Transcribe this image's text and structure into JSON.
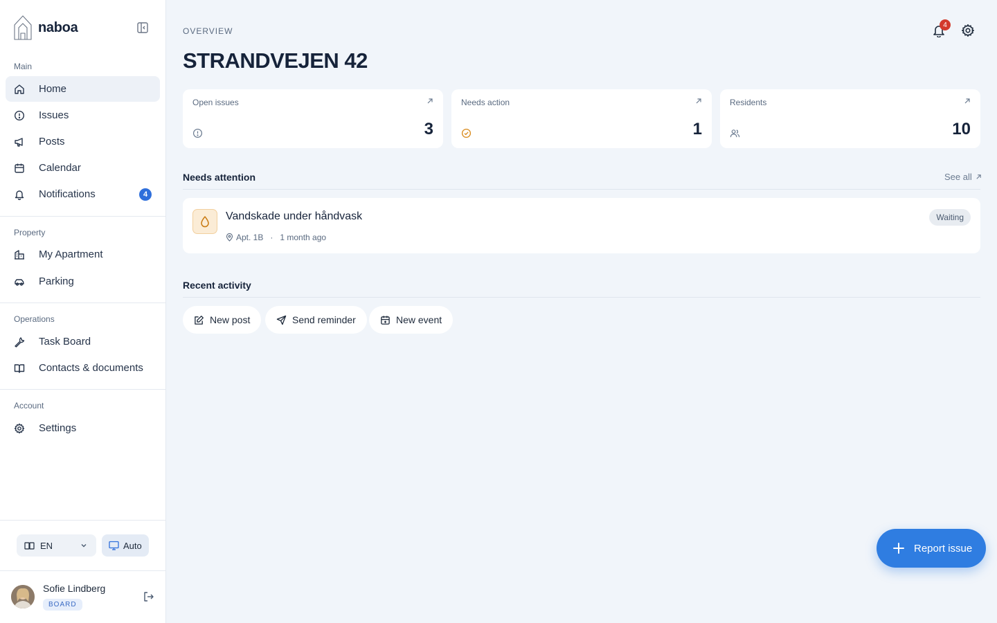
{
  "brand": {
    "name": "naboa"
  },
  "sidebar": {
    "sections": [
      {
        "label": "Main"
      },
      {
        "label": "Property"
      },
      {
        "label": "Operations"
      },
      {
        "label": "Account"
      }
    ],
    "items": [
      {
        "label": "Home",
        "icon": "home-icon",
        "active": true
      },
      {
        "label": "Issues",
        "icon": "alert-circle-icon"
      },
      {
        "label": "Posts",
        "icon": "megaphone-icon"
      },
      {
        "label": "Calendar",
        "icon": "calendar-icon"
      },
      {
        "label": "Notifications",
        "icon": "bell-icon",
        "badge": "4"
      },
      {
        "label": "My Apartment",
        "icon": "building-icon"
      },
      {
        "label": "Parking",
        "icon": "car-icon"
      },
      {
        "label": "Task Board",
        "icon": "wrench-icon"
      },
      {
        "label": "Contacts & documents",
        "icon": "book-icon"
      },
      {
        "label": "Settings",
        "icon": "gear-icon"
      }
    ],
    "language": {
      "selected": "EN"
    },
    "theme": {
      "label": "Auto"
    },
    "user": {
      "name": "Sofie Lindberg",
      "role": "BOARD"
    }
  },
  "header": {
    "overline": "OVERVIEW",
    "title": "STRANDVEJEN 42",
    "notification_count": "4"
  },
  "stats": [
    {
      "label": "Open issues",
      "value": "3",
      "icon": "alert-circle-icon"
    },
    {
      "label": "Needs action",
      "value": "1",
      "icon": "check-circle-icon"
    },
    {
      "label": "Residents",
      "value": "10",
      "icon": "users-icon"
    }
  ],
  "needs_attention": {
    "heading": "Needs attention",
    "see_all": "See all",
    "items": [
      {
        "title": "Vandskade under håndvask",
        "location": "Apt. 1B",
        "time": "1 month ago",
        "status": "Waiting",
        "icon": "droplet-icon"
      }
    ]
  },
  "recent_activity": {
    "heading": "Recent activity",
    "actions": [
      {
        "label": "New post",
        "icon": "edit-icon"
      },
      {
        "label": "Send reminder",
        "icon": "send-icon"
      },
      {
        "label": "New event",
        "icon": "calendar-plus-icon"
      }
    ]
  },
  "fab": {
    "label": "Report issue"
  },
  "colors": {
    "accent": "#2f7de1",
    "badge": "#2f6fdb",
    "alert": "#d33a2c",
    "warning": "#d98a1c"
  }
}
